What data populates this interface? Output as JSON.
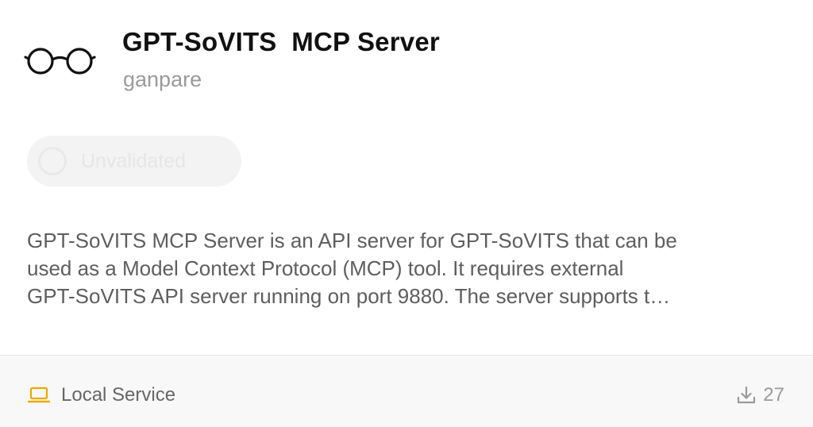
{
  "server": {
    "title": "GPT-SoVITS  MCP Server",
    "author": "ganpare",
    "badge_label": "Unvalidated",
    "description": "GPT-SoVITS  MCP Server is an API server for GPT-SoVITS  that can be\nused as a Model Context Protocol (MCP) tool. It requires external\nGPT-SoVITS  API server running on port 9880. The server supports t…"
  },
  "footer": {
    "service_label": "Local Service",
    "download_count": "27"
  },
  "icons": {
    "logo": "glasses-icon",
    "badge": "status-circle-icon",
    "service": "laptop-icon",
    "downloads": "download-icon"
  },
  "colors": {
    "title": "#111111",
    "muted": "#9a9a9a",
    "text": "#5e5e5e",
    "accent": "#f0a800",
    "footer_bg": "#f8f8f8"
  }
}
